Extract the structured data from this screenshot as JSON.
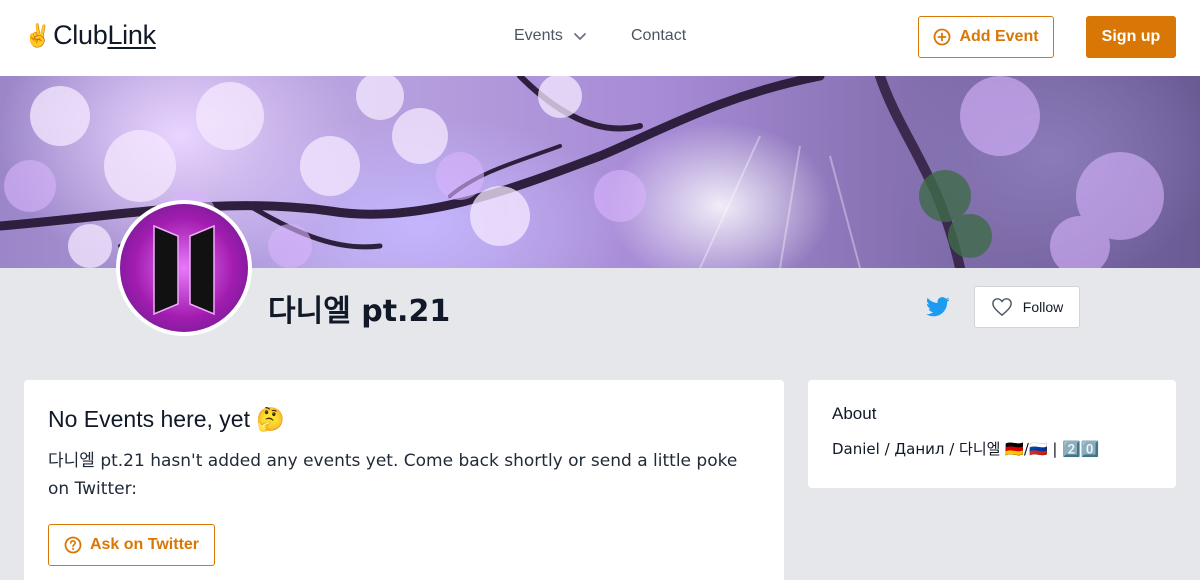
{
  "header": {
    "logo_emoji": "✌️",
    "logo_club": "Club",
    "logo_link": "Link",
    "nav_events": "Events",
    "nav_contact": "Contact",
    "add_event_label": "Add Event",
    "signup_label": "Sign up"
  },
  "profile": {
    "name": "다니엘 pt.21",
    "follow_label": "Follow"
  },
  "main": {
    "title": "No Events here, yet 🤔",
    "message": "다니엘 pt.21 hasn't added any events yet. Come back shortly or send a little poke on Twitter:",
    "ask_button_label": "Ask on Twitter"
  },
  "about": {
    "title": "About",
    "text": "Daniel / Данил / 다니엘 🇩🇪/🇷🇺 | 2️⃣0️⃣"
  },
  "colors": {
    "accent": "#d97706",
    "twitter": "#1d9bf0",
    "page_bg": "#e5e7eb"
  },
  "icons": [
    "clublink-logo",
    "chevron-down-icon",
    "plus-circle-icon",
    "twitter-icon",
    "heart-icon",
    "question-circle-icon"
  ]
}
